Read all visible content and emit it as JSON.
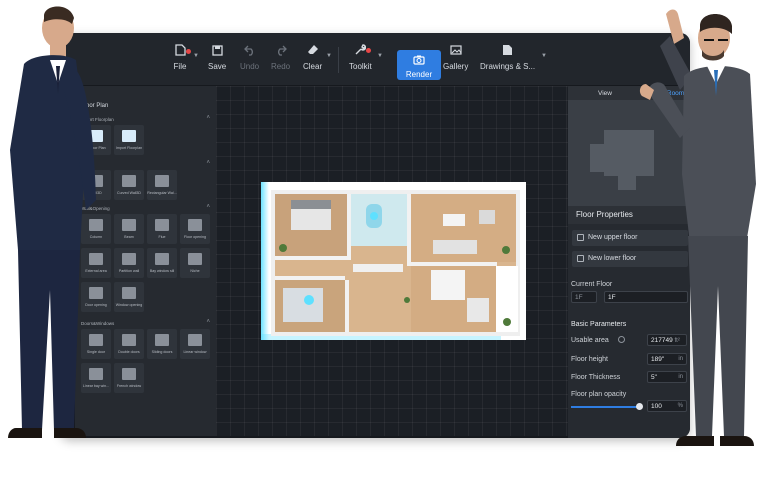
{
  "toolbar": {
    "items": [
      {
        "label": "File",
        "icon": "file-icon",
        "state": "normal"
      },
      {
        "label": "Save",
        "icon": "save-icon",
        "state": "normal"
      },
      {
        "label": "Undo",
        "icon": "undo-icon",
        "state": "disabled"
      },
      {
        "label": "Redo",
        "icon": "redo-icon",
        "state": "disabled"
      },
      {
        "label": "Clear",
        "icon": "eraser-icon",
        "state": "normal"
      },
      {
        "label": "Toolkit",
        "icon": "wrench-icon",
        "state": "normal"
      },
      {
        "label": "Render",
        "icon": "camera-icon",
        "state": "active"
      },
      {
        "label": "Gallery",
        "icon": "gallery-icon",
        "state": "normal"
      },
      {
        "label": "Drawings & S...",
        "icon": "drawings-icon",
        "state": "normal"
      }
    ]
  },
  "left_panel": {
    "title": "Floor Plan",
    "sections": [
      "Import Floorplan",
      "Wall&Opening",
      "Doors&Windows"
    ],
    "tiles": [
      {
        "label": "n Floor Plan"
      },
      {
        "label": "Import Floorplan"
      },
      {
        "label": "Wall3D"
      },
      {
        "label": "Curved Wall3D"
      },
      {
        "label": "Rectangular Wal..."
      },
      {
        "label": "Column"
      },
      {
        "label": "Beam"
      },
      {
        "label": "Flue"
      },
      {
        "label": "Floor opening"
      },
      {
        "label": "External area"
      },
      {
        "label": "Partition wall"
      },
      {
        "label": "Bay window sill"
      },
      {
        "label": "Niche"
      },
      {
        "label": "Door opening"
      },
      {
        "label": "Window opening"
      },
      {
        "label": "Single door"
      },
      {
        "label": "Double doors"
      },
      {
        "label": "Sliding doors"
      },
      {
        "label": "Linear window"
      },
      {
        "label": "Linear bay win..."
      },
      {
        "label": "French window"
      }
    ]
  },
  "right_panel": {
    "view_label": "View",
    "select_label": "Select Room",
    "floor_properties_title": "Floor Properties",
    "new_upper_floor": "New upper floor",
    "new_lower_floor": "New lower floor",
    "current_floor_label": "Current Floor",
    "current_floor_short": "1F",
    "current_floor_value": "1F",
    "basic_parameters_title": "Basic Parameters",
    "usable_area_label": "Usable area",
    "usable_area_value": "217749",
    "usable_area_unit": "ft²",
    "floor_height_label": "Floor height",
    "floor_height_value": "189\"",
    "floor_height_unit": "in",
    "floor_thickness_label": "Floor Thickness",
    "floor_thickness_value": "5\"",
    "floor_thickness_unit": "in",
    "floor_plan_opacity_label": "Floor plan opacity",
    "opacity_value": "100",
    "opacity_unit": "%",
    "opacity_fraction": 1.0
  },
  "colors": {
    "accent": "#2f7de1",
    "select_link": "#4ea3ff",
    "notification_dot": "#e84747",
    "floorplan_glow": "#5ee0ff"
  }
}
